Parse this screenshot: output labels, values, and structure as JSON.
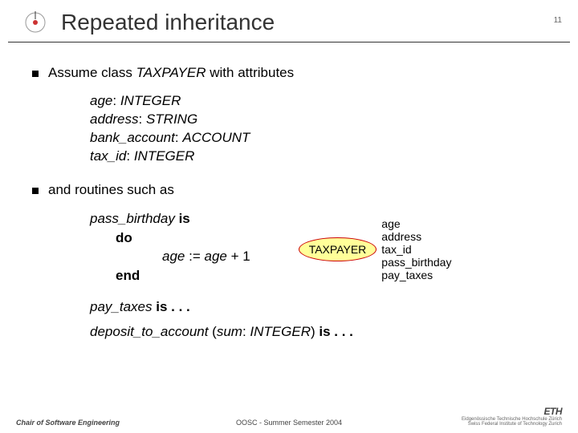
{
  "header": {
    "title": "Repeated inheritance",
    "page_number": "11"
  },
  "bullets": {
    "line1_prefix": "Assume class ",
    "line1_class": "TAXPAYER",
    "line1_suffix": " with attributes",
    "line2": "and routines such as"
  },
  "attributes": [
    {
      "name": "age",
      "type": "INTEGER"
    },
    {
      "name": "address",
      "type": "STRING"
    },
    {
      "name": "bank_account",
      "type": "ACCOUNT"
    },
    {
      "name": "tax_id",
      "type": "INTEGER"
    }
  ],
  "routine": {
    "name": "pass_birthday",
    "kw_is": "is",
    "kw_do": "do",
    "body_lhs": "age",
    "body_op": " := ",
    "body_rhs": "age",
    "body_plus": " + 1",
    "kw_end": "end"
  },
  "diagram": {
    "node": "TAXPAYER",
    "labels": [
      "age",
      "address",
      "tax_id",
      "pass_birthday",
      "pay_taxes"
    ]
  },
  "more": {
    "r1_name": "pay_taxes",
    "r1_rest": " is . . .",
    "r2_name": "deposit_to_account",
    "r2_paren_open": " (",
    "r2_param": "sum",
    "r2_colon": ": ",
    "r2_type": "INTEGER",
    "r2_paren_close": ")",
    "r2_rest": " is . . ."
  },
  "footer": {
    "left": "Chair of Software Engineering",
    "center": "OOSC - Summer Semester 2004",
    "eth": "ETH",
    "eth_sub1": "Eidgenössische Technische Hochschule Zürich",
    "eth_sub2": "Swiss Federal Institute of Technology Zurich"
  }
}
